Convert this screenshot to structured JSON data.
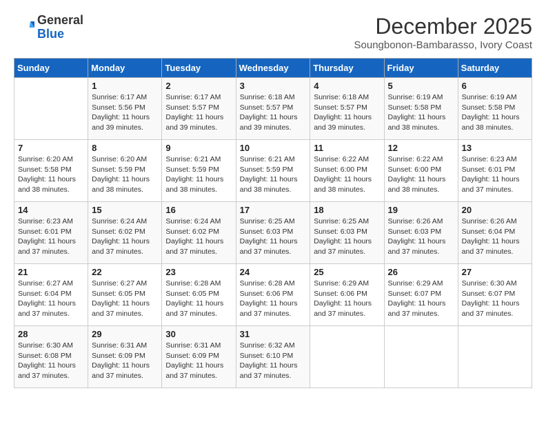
{
  "header": {
    "logo": {
      "general": "General",
      "blue": "Blue"
    },
    "month_year": "December 2025",
    "location": "Soungbonon-Bambarasso, Ivory Coast"
  },
  "weekdays": [
    "Sunday",
    "Monday",
    "Tuesday",
    "Wednesday",
    "Thursday",
    "Friday",
    "Saturday"
  ],
  "weeks": [
    [
      {
        "day": "",
        "info": ""
      },
      {
        "day": "1",
        "info": "Sunrise: 6:17 AM\nSunset: 5:56 PM\nDaylight: 11 hours\nand 39 minutes."
      },
      {
        "day": "2",
        "info": "Sunrise: 6:17 AM\nSunset: 5:57 PM\nDaylight: 11 hours\nand 39 minutes."
      },
      {
        "day": "3",
        "info": "Sunrise: 6:18 AM\nSunset: 5:57 PM\nDaylight: 11 hours\nand 39 minutes."
      },
      {
        "day": "4",
        "info": "Sunrise: 6:18 AM\nSunset: 5:57 PM\nDaylight: 11 hours\nand 39 minutes."
      },
      {
        "day": "5",
        "info": "Sunrise: 6:19 AM\nSunset: 5:58 PM\nDaylight: 11 hours\nand 38 minutes."
      },
      {
        "day": "6",
        "info": "Sunrise: 6:19 AM\nSunset: 5:58 PM\nDaylight: 11 hours\nand 38 minutes."
      }
    ],
    [
      {
        "day": "7",
        "info": "Sunrise: 6:20 AM\nSunset: 5:58 PM\nDaylight: 11 hours\nand 38 minutes."
      },
      {
        "day": "8",
        "info": "Sunrise: 6:20 AM\nSunset: 5:59 PM\nDaylight: 11 hours\nand 38 minutes."
      },
      {
        "day": "9",
        "info": "Sunrise: 6:21 AM\nSunset: 5:59 PM\nDaylight: 11 hours\nand 38 minutes."
      },
      {
        "day": "10",
        "info": "Sunrise: 6:21 AM\nSunset: 5:59 PM\nDaylight: 11 hours\nand 38 minutes."
      },
      {
        "day": "11",
        "info": "Sunrise: 6:22 AM\nSunset: 6:00 PM\nDaylight: 11 hours\nand 38 minutes."
      },
      {
        "day": "12",
        "info": "Sunrise: 6:22 AM\nSunset: 6:00 PM\nDaylight: 11 hours\nand 38 minutes."
      },
      {
        "day": "13",
        "info": "Sunrise: 6:23 AM\nSunset: 6:01 PM\nDaylight: 11 hours\nand 37 minutes."
      }
    ],
    [
      {
        "day": "14",
        "info": "Sunrise: 6:23 AM\nSunset: 6:01 PM\nDaylight: 11 hours\nand 37 minutes."
      },
      {
        "day": "15",
        "info": "Sunrise: 6:24 AM\nSunset: 6:02 PM\nDaylight: 11 hours\nand 37 minutes."
      },
      {
        "day": "16",
        "info": "Sunrise: 6:24 AM\nSunset: 6:02 PM\nDaylight: 11 hours\nand 37 minutes."
      },
      {
        "day": "17",
        "info": "Sunrise: 6:25 AM\nSunset: 6:03 PM\nDaylight: 11 hours\nand 37 minutes."
      },
      {
        "day": "18",
        "info": "Sunrise: 6:25 AM\nSunset: 6:03 PM\nDaylight: 11 hours\nand 37 minutes."
      },
      {
        "day": "19",
        "info": "Sunrise: 6:26 AM\nSunset: 6:03 PM\nDaylight: 11 hours\nand 37 minutes."
      },
      {
        "day": "20",
        "info": "Sunrise: 6:26 AM\nSunset: 6:04 PM\nDaylight: 11 hours\nand 37 minutes."
      }
    ],
    [
      {
        "day": "21",
        "info": "Sunrise: 6:27 AM\nSunset: 6:04 PM\nDaylight: 11 hours\nand 37 minutes."
      },
      {
        "day": "22",
        "info": "Sunrise: 6:27 AM\nSunset: 6:05 PM\nDaylight: 11 hours\nand 37 minutes."
      },
      {
        "day": "23",
        "info": "Sunrise: 6:28 AM\nSunset: 6:05 PM\nDaylight: 11 hours\nand 37 minutes."
      },
      {
        "day": "24",
        "info": "Sunrise: 6:28 AM\nSunset: 6:06 PM\nDaylight: 11 hours\nand 37 minutes."
      },
      {
        "day": "25",
        "info": "Sunrise: 6:29 AM\nSunset: 6:06 PM\nDaylight: 11 hours\nand 37 minutes."
      },
      {
        "day": "26",
        "info": "Sunrise: 6:29 AM\nSunset: 6:07 PM\nDaylight: 11 hours\nand 37 minutes."
      },
      {
        "day": "27",
        "info": "Sunrise: 6:30 AM\nSunset: 6:07 PM\nDaylight: 11 hours\nand 37 minutes."
      }
    ],
    [
      {
        "day": "28",
        "info": "Sunrise: 6:30 AM\nSunset: 6:08 PM\nDaylight: 11 hours\nand 37 minutes."
      },
      {
        "day": "29",
        "info": "Sunrise: 6:31 AM\nSunset: 6:09 PM\nDaylight: 11 hours\nand 37 minutes."
      },
      {
        "day": "30",
        "info": "Sunrise: 6:31 AM\nSunset: 6:09 PM\nDaylight: 11 hours\nand 37 minutes."
      },
      {
        "day": "31",
        "info": "Sunrise: 6:32 AM\nSunset: 6:10 PM\nDaylight: 11 hours\nand 37 minutes."
      },
      {
        "day": "",
        "info": ""
      },
      {
        "day": "",
        "info": ""
      },
      {
        "day": "",
        "info": ""
      }
    ]
  ]
}
